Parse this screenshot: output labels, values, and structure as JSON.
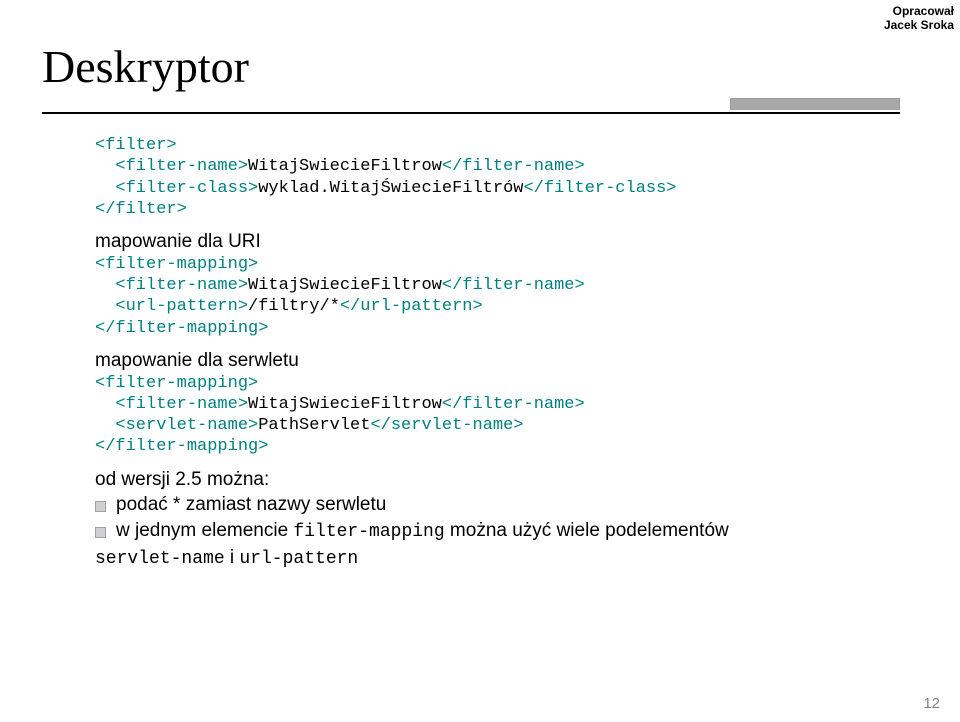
{
  "credit": {
    "line1": "Opracował",
    "line2": "Jacek Sroka"
  },
  "title": "Deskryptor",
  "block1": {
    "l1a": "<filter>",
    "l2a": "  <filter-name>",
    "l2b": "WitajSwiecieFiltrow",
    "l2c": "</filter-name>",
    "l3a": "  <filter-class>",
    "l3b": "wyklad.WitajŚwiecieFiltrów",
    "l3c": "</filter-class>",
    "l4a": "</filter>"
  },
  "label2": "mapowanie dla URI",
  "block2": {
    "l1a": "<filter-mapping>",
    "l2a": "  <filter-name>",
    "l2b": "WitajSwiecieFiltrow",
    "l2c": "</filter-name>",
    "l3a": "  <url-pattern>",
    "l3b": "/filtry/*",
    "l3c": "</url-pattern>",
    "l4a": "</filter-mapping>"
  },
  "label3": "mapowanie dla serwletu",
  "block3": {
    "l1a": "<filter-mapping>",
    "l2a": "  <filter-name>",
    "l2b": "WitajSwiecieFiltrow",
    "l2c": "</filter-name>",
    "l3a": "  <servlet-name>",
    "l3b": "PathServlet",
    "l3c": "</servlet-name>",
    "l4a": "</filter-mapping>"
  },
  "footer": {
    "heading": "od wersji 2.5 można:",
    "b1": "podać * zamiast nazwy serwletu",
    "b2a": "w jednym elemencie ",
    "b2b": "filter-mapping",
    "b2c": " można użyć wiele podelementów",
    "b3a": "servlet-name",
    "b3b": " i ",
    "b3c": "url-pattern"
  },
  "page_number": "12"
}
